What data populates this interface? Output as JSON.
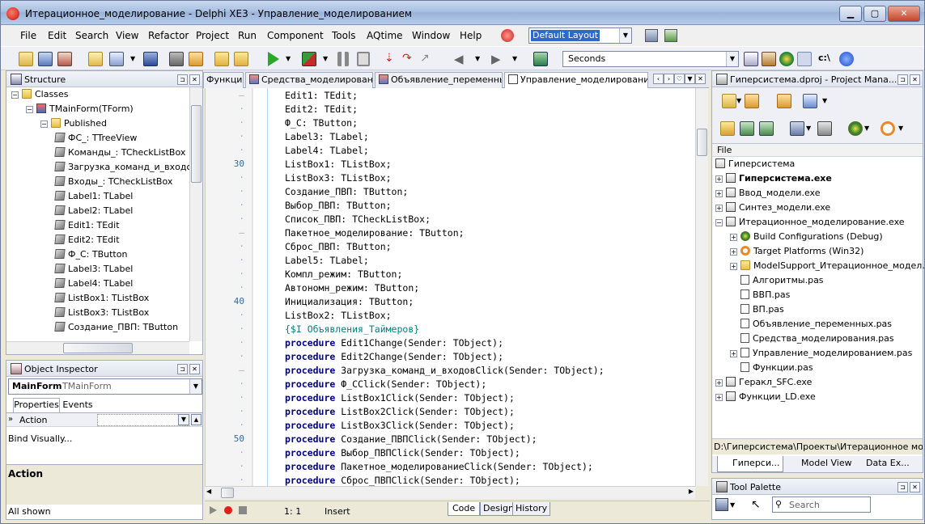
{
  "window": {
    "title": "Итерационное_моделирование - Delphi XE3 - Управление_моделированием"
  },
  "menu": {
    "items": [
      "File",
      "Edit",
      "Search",
      "View",
      "Refactor",
      "Project",
      "Run",
      "Component",
      "Tools",
      "AQtime",
      "Window",
      "Help"
    ],
    "layout_combo": "Default Layout"
  },
  "toolbar": {
    "seconds_combo": "Seconds"
  },
  "structure": {
    "title": "Structure",
    "items": [
      "Classes",
      "TMainForm(TForm)",
      "Published",
      "ФС_: TTreeView",
      "Команды_: TCheckListBox",
      "Загрузка_команд_и_входо",
      "Входы_: TCheckListBox",
      "Label1: TLabel",
      "Label2: TLabel",
      "Edit1: TEdit",
      "Edit2: TEdit",
      "Ф_С: TButton",
      "Label3: TLabel",
      "Label4: TLabel",
      "ListBox1: TListBox",
      "ListBox3: TListBox",
      "Создание_ПВП: TButton"
    ]
  },
  "inspector": {
    "title": "Object Inspector",
    "object_name": "MainForm",
    "object_type": "TMainForm",
    "tab_properties": "Properties",
    "tab_events": "Events",
    "action_label": "Action",
    "bind_visually": "Bind Visually...",
    "desc_title": "Action",
    "footer": "All shown"
  },
  "editor": {
    "tabs": [
      "Функции",
      "Средства_моделирования",
      "Объявление_переменных",
      "Управление_моделированием"
    ],
    "line_numbers": [
      {
        "row": 5,
        "num": "30"
      },
      {
        "row": 15,
        "num": "40"
      },
      {
        "row": 25,
        "num": "50"
      }
    ],
    "lines": [
      {
        "type": "plain",
        "text": "Edit1: TEdit;"
      },
      {
        "type": "plain",
        "text": "Edit2: TEdit;"
      },
      {
        "type": "plain",
        "text": "Ф_С: TButton;"
      },
      {
        "type": "plain",
        "text": "Label3: TLabel;"
      },
      {
        "type": "plain",
        "text": "Label4: TLabel;"
      },
      {
        "type": "plain",
        "text": "ListBox1: TListBox;"
      },
      {
        "type": "plain",
        "text": "ListBox3: TListBox;"
      },
      {
        "type": "plain",
        "text": "Создание_ПВП: TButton;"
      },
      {
        "type": "plain",
        "text": "Выбор_ПВП: TButton;"
      },
      {
        "type": "plain",
        "text": "Список_ПВП: TCheckListBox;"
      },
      {
        "type": "plain",
        "text": "Пакетное_моделирование: TButton;"
      },
      {
        "type": "plain",
        "text": "Сброс_ПВП: TButton;"
      },
      {
        "type": "plain",
        "text": "Label5: TLabel;"
      },
      {
        "type": "plain",
        "text": "Компл_режим: TButton;"
      },
      {
        "type": "plain",
        "text": "Автономн_режим: TButton;"
      },
      {
        "type": "plain",
        "text": "Инициализация: TButton;"
      },
      {
        "type": "plain",
        "text": "ListBox2: TListBox;"
      },
      {
        "type": "dir",
        "text": "{$I Объявления_Таймеров}"
      },
      {
        "type": "proc",
        "kw": "procedure",
        "text": " Edit1Change(Sender: TObject);"
      },
      {
        "type": "proc",
        "kw": "procedure",
        "text": " Edit2Change(Sender: TObject);"
      },
      {
        "type": "proc",
        "kw": "procedure",
        "text": " Загрузка_команд_и_входовClick(Sender: TObject);"
      },
      {
        "type": "proc",
        "kw": "procedure",
        "text": " Ф_CClick(Sender: TObject);"
      },
      {
        "type": "proc",
        "kw": "procedure",
        "text": " ListBox1Click(Sender: TObject);"
      },
      {
        "type": "proc",
        "kw": "procedure",
        "text": " ListBox2Click(Sender: TObject);"
      },
      {
        "type": "proc",
        "kw": "procedure",
        "text": " ListBox3Click(Sender: TObject);"
      },
      {
        "type": "proc",
        "kw": "procedure",
        "text": " Создание_ПВПClick(Sender: TObject);"
      },
      {
        "type": "proc",
        "kw": "procedure",
        "text": " Выбор_ПВПClick(Sender: TObject);"
      },
      {
        "type": "proc",
        "kw": "procedure",
        "text": " Пакетное_моделированиеClick(Sender: TObject);"
      },
      {
        "type": "proc",
        "kw": "procedure",
        "text": " Сброс_ПВПClick(Sender: TObject);"
      }
    ],
    "status_pos": "1:  1",
    "status_mode": "Insert",
    "bottom_tabs": [
      "Code",
      "Design",
      "History"
    ]
  },
  "project": {
    "title": "Гиперсистема.dproj - Project Mana...",
    "column": "File",
    "items": [
      {
        "text": "Гиперсистема",
        "bold": false
      },
      {
        "text": "Гиперсистема.exe",
        "bold": true
      },
      {
        "text": "Ввод_модели.exe",
        "bold": false
      },
      {
        "text": "Синтез_модели.exe",
        "bold": false
      },
      {
        "text": "Итерационное_моделирование.exe",
        "bold": false
      },
      {
        "text": "Build Configurations (Debug)",
        "bold": false
      },
      {
        "text": "Target Platforms (Win32)",
        "bold": false
      },
      {
        "text": "ModelSupport_Итерационное_модел...",
        "bold": false
      },
      {
        "text": "Алгоритмы.pas",
        "bold": false
      },
      {
        "text": "ВВП.pas",
        "bold": false
      },
      {
        "text": "ВП.pas",
        "bold": false
      },
      {
        "text": "Объявление_переменных.pas",
        "bold": false
      },
      {
        "text": "Средства_моделирования.pas",
        "bold": false
      },
      {
        "text": "Управление_моделированием.pas",
        "bold": false
      },
      {
        "text": "Функции.pas",
        "bold": false
      },
      {
        "text": "Геракл_SFC.exe",
        "bold": false
      },
      {
        "text": "Функции_LD.exe",
        "bold": false
      }
    ],
    "path": "D:\\Гиперсистема\\Проекты\\Итерационное моделир",
    "tabs": [
      "Гиперси...",
      "Model View",
      "Data Ex..."
    ]
  },
  "palette": {
    "title": "Tool Palette",
    "search_placeholder": "Search"
  }
}
